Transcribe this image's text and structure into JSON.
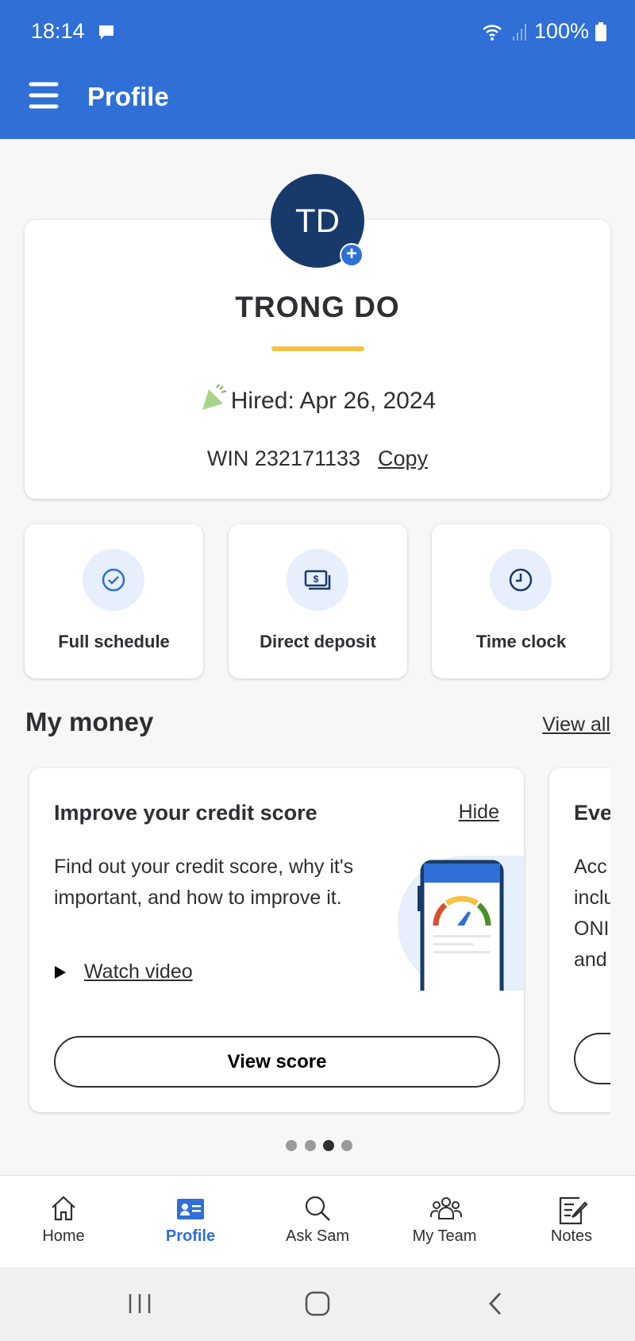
{
  "status_bar": {
    "time": "18:14",
    "battery": "100%",
    "icons": [
      "message-icon",
      "wifi-icon",
      "signal-icon",
      "battery-icon"
    ]
  },
  "header": {
    "title": "Profile",
    "menu_icon": "hamburger-icon"
  },
  "profile": {
    "initials": "TD",
    "name": "TRONG DO",
    "hired": "Hired: Apr 26, 2024",
    "win": "WIN 232171133",
    "copy_label": "Copy",
    "accent": "#f5c242"
  },
  "tiles": [
    {
      "label": "Full schedule",
      "icon": "check-circle-icon"
    },
    {
      "label": "Direct deposit",
      "icon": "money-icon"
    },
    {
      "label": "Time clock",
      "icon": "clock-icon"
    }
  ],
  "my_money": {
    "title": "My money",
    "view_all": "View all",
    "card": {
      "title": "Improve your credit score",
      "hide": "Hide",
      "description": "Find out your credit score, why it's important, and how to improve it.",
      "watch_video": "Watch video",
      "button": "View score"
    },
    "next_card": {
      "title": "Eve",
      "lines": [
        "Acc",
        "inclu",
        "ONI",
        "and"
      ]
    },
    "carousel": {
      "count": 4,
      "active": 3
    }
  },
  "bottom_nav": [
    {
      "label": "Home",
      "icon": "home-icon"
    },
    {
      "label": "Profile",
      "icon": "profile-card-icon",
      "active": true
    },
    {
      "label": "Ask Sam",
      "icon": "search-icon"
    },
    {
      "label": "My Team",
      "icon": "team-icon"
    },
    {
      "label": "Notes",
      "icon": "notes-icon"
    }
  ],
  "colors": {
    "primary": "#2f6fd6",
    "dark_blue": "#183a6b"
  }
}
